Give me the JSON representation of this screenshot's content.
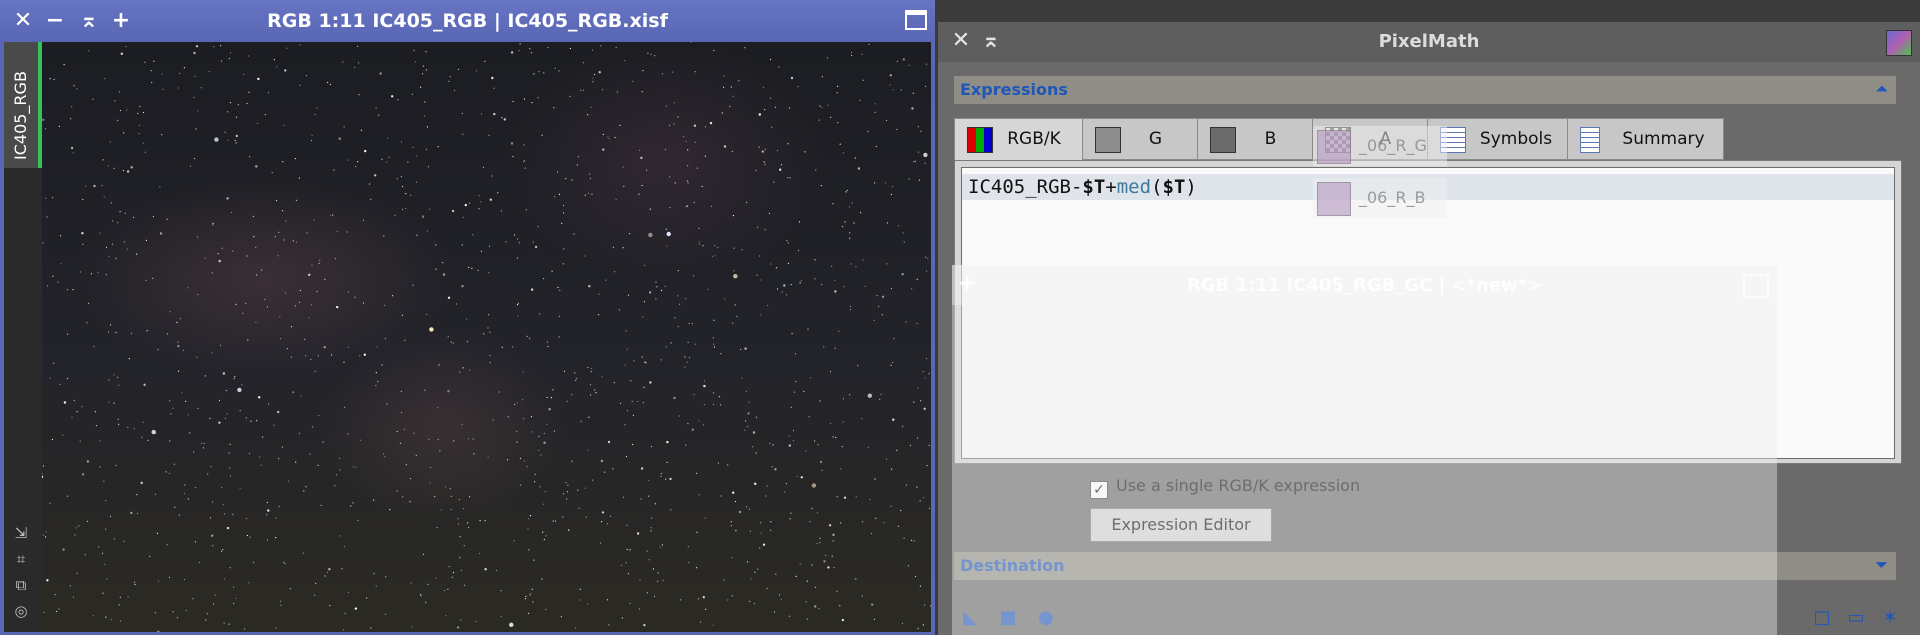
{
  "image_window": {
    "title": "RGB 1:11 IC405_RGB | IC405_RGB.xisf",
    "tab_label": "IC405_RGB",
    "buttons": {
      "close": "✕",
      "minimize": "−",
      "shade": "⌅",
      "add": "+"
    }
  },
  "pixelmath": {
    "title": "PixelMath",
    "expressions_label": "Expressions",
    "tabs": [
      {
        "label": "RGB/K"
      },
      {
        "label": "G"
      },
      {
        "label": "B"
      },
      {
        "label": "A"
      },
      {
        "label": "Symbols"
      },
      {
        "label": "Summary"
      }
    ],
    "expression": {
      "p1": "IC405_RGB-",
      "p2": "$T",
      "p3": "+",
      "p4": "med",
      "p5": "(",
      "p6": "$T",
      "p7": ")"
    },
    "checkbox_label": "Use a single RGB/K expression",
    "checkbox_checked": "✓",
    "expression_editor_label": "Expression Editor",
    "destination_label": "Destination"
  },
  "ghost_window": {
    "title": "RGB 1:11 IC405_RGB_GC | <*new*>",
    "plus": "+"
  },
  "thumbnails": [
    {
      "label": "_06_R_G"
    },
    {
      "label": "_06_R_B"
    }
  ],
  "colors": {
    "accent_blue": "#1e57b8",
    "title_blue": "#5866b4",
    "active_green": "#33c35a"
  }
}
